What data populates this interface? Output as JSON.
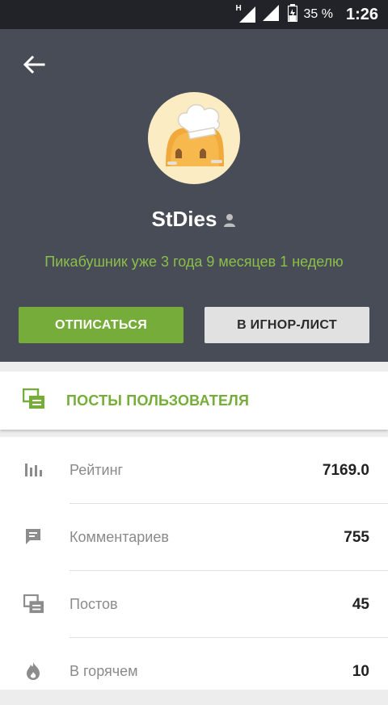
{
  "status_bar": {
    "network": "H",
    "battery_percent": "35 %",
    "time": "1:26"
  },
  "profile": {
    "username": "StDies",
    "since_text": "Пикабушник уже 3 года 9 месяцев 1 неделю"
  },
  "actions": {
    "unsubscribe_label": "ОТПИСАТЬСЯ",
    "ignore_label": "В ИГНОР-ЛИСТ"
  },
  "posts_card": {
    "label": "ПОСТЫ ПОЛЬЗОВАТЕЛЯ"
  },
  "stats": [
    {
      "label": "Рейтинг",
      "value": "7169.0",
      "icon": "bar-chart-icon"
    },
    {
      "label": "Комментариев",
      "value": "755",
      "icon": "comment-icon"
    },
    {
      "label": "Постов",
      "value": "45",
      "icon": "posts-icon"
    },
    {
      "label": "В горячем",
      "value": "10",
      "icon": "fire-icon"
    }
  ],
  "colors": {
    "header_bg": "#484c56",
    "accent_green": "#76ad3a",
    "since_green": "#8cbf4a",
    "status_bar_bg": "#212328"
  }
}
